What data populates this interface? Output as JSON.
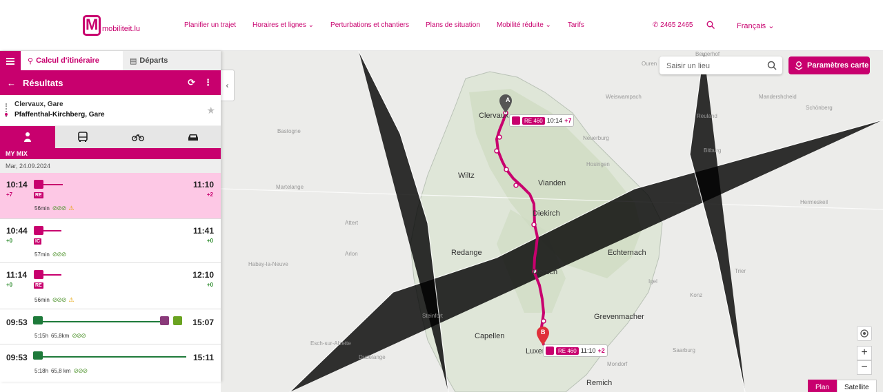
{
  "header": {
    "logo_text": "mobiliteit.lu",
    "nav": [
      "Planifier un trajet",
      "Horaires et lignes ⌄",
      "Perturbations et chantiers",
      "Plans de situation",
      "Mobilité réduite ⌄",
      "Tarifs"
    ],
    "phone": "2465 2465",
    "language": "Français ⌄"
  },
  "panel": {
    "tab_itinerary": "Calcul d'itinéraire",
    "tab_departures": "Départs",
    "results_title": "Résultats",
    "origin": "Clervaux, Gare",
    "destination": "Pfaffenthal-Kirchberg, Gare",
    "mode_label": "MY MIX",
    "date": "Mar, 24.09.2024",
    "trips": [
      {
        "dep": "10:14",
        "dep_delay": "+7",
        "arr": "11:10",
        "arr_delay": "+2",
        "line": "RE",
        "duration": "56min",
        "leaves": "⊘⊘⊘",
        "warning": "⚠"
      },
      {
        "dep": "10:44",
        "dep_delay": "+0",
        "arr": "11:41",
        "arr_delay": "+0",
        "line": "IC",
        "duration": "57min",
        "leaves": "⊘⊘⊘",
        "warning": ""
      },
      {
        "dep": "11:14",
        "dep_delay": "+0",
        "arr": "12:10",
        "arr_delay": "+0",
        "line": "RE",
        "duration": "56min",
        "leaves": "⊘⊘⊘",
        "warning": "⚠"
      },
      {
        "dep": "09:53",
        "arr": "15:07",
        "duration": "5:15h",
        "distance": "65,8km",
        "leaves": "⊘⊘⊘"
      },
      {
        "dep": "09:53",
        "arr": "15:11",
        "duration": "5:18h",
        "distance": "65,8 km",
        "leaves": "⊘⊘⊘"
      }
    ]
  },
  "map": {
    "search_placeholder": "Saisir un lieu",
    "params_button": "Paramètres carte",
    "plan": "Plan",
    "satellite": "Satellite",
    "zoom_in": "+",
    "zoom_out": "−",
    "marker_a": "A",
    "marker_b": "B",
    "bubble_a": {
      "line": "RE 460",
      "time": "10:14",
      "delay": "+7"
    },
    "bubble_b": {
      "line": "RE 460",
      "time": "11:10",
      "delay": "+2"
    },
    "cities": [
      "Clervaux",
      "Wiltz",
      "Vianden",
      "Diekirch",
      "Redange",
      "Echternach",
      "Mersch",
      "Grevenmacher",
      "Capellen",
      "Luxembourg",
      "Remich"
    ],
    "small_places": [
      "Bergerhof",
      "Weiswampach",
      "Ouren",
      "Reuland",
      "Schönberg",
      "Hosingen",
      "Neuerburg",
      "Mandershcheid",
      "Bitburg",
      "Bastogne",
      "Martelange",
      "Arlon",
      "Trier",
      "Konz",
      "Saarburg",
      "Mondorf",
      "Dudelange",
      "Esch-sur-Alzette",
      "Steinfort",
      "Habay-la-Neuve",
      "Attert",
      "Hermeskeil",
      "Igel"
    ]
  },
  "colors": {
    "brand": "#c8006e"
  }
}
